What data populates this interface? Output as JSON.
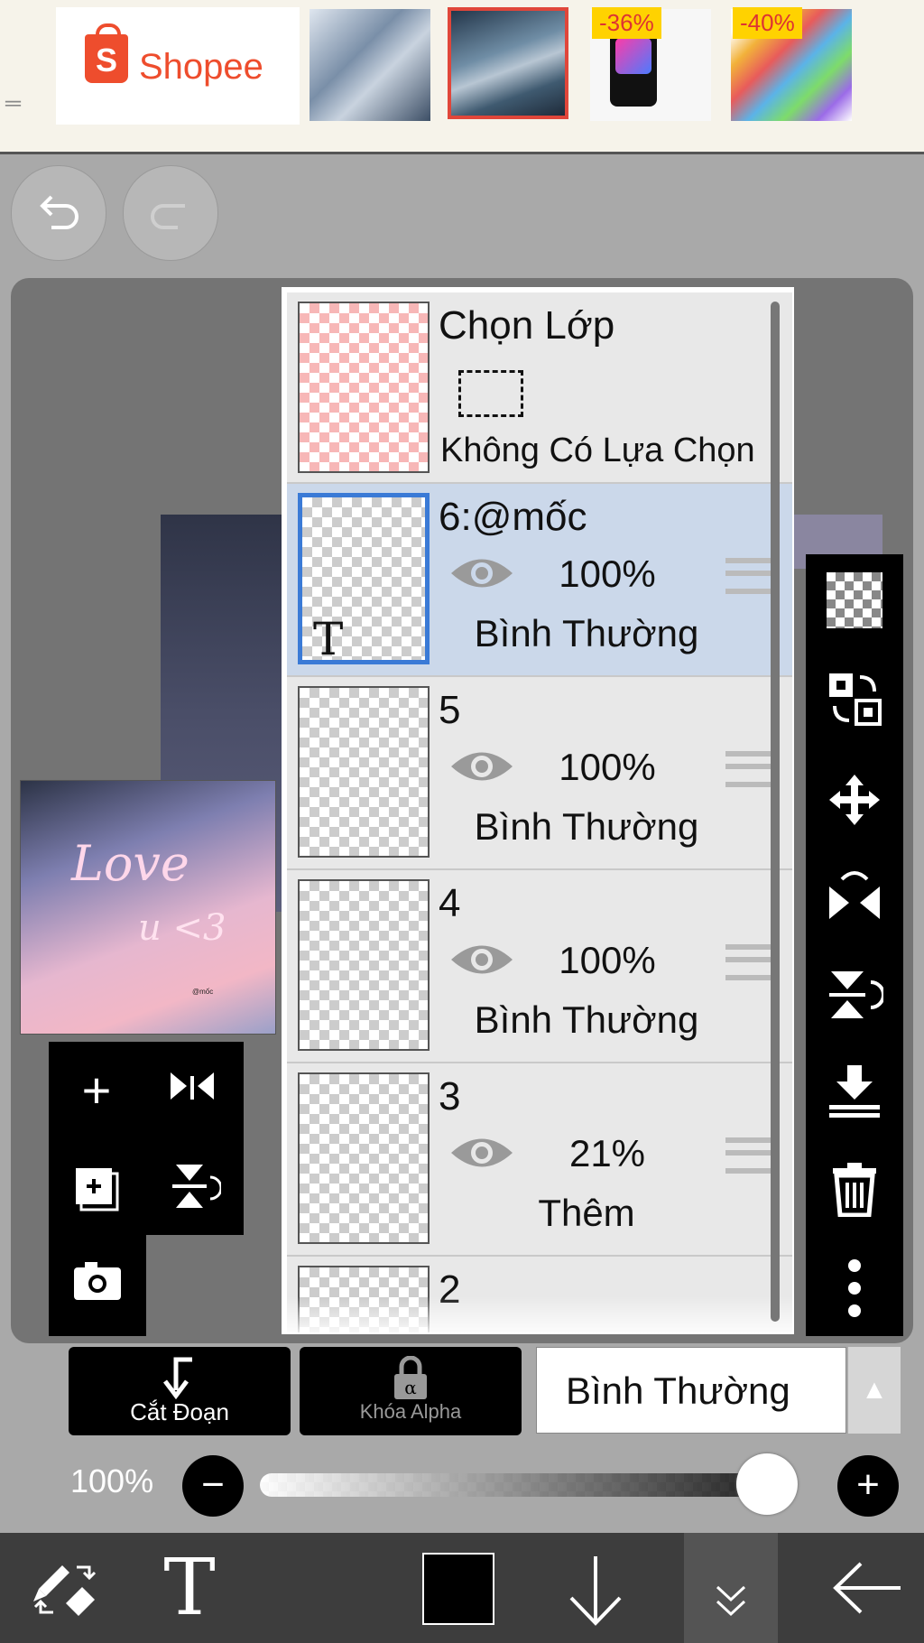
{
  "ad": {
    "brand": "Shopee",
    "discount_1": "-36%",
    "discount_2": "-40%"
  },
  "thumbnail": {
    "text_love": "Love",
    "text_u3": "u <3",
    "small_text": "@mốc"
  },
  "layers_panel": {
    "selection": {
      "title": "Chọn Lớp",
      "status": "Không Có Lựa Chọn"
    },
    "layers": [
      {
        "name": "6:@mốc",
        "opacity": "100%",
        "blend": "Bình Thường",
        "thumb_label": "T"
      },
      {
        "name": "5",
        "opacity": "100%",
        "blend": "Bình Thường"
      },
      {
        "name": "4",
        "opacity": "100%",
        "blend": "Bình Thường"
      },
      {
        "name": "3",
        "opacity": "21%",
        "blend": "Thêm"
      },
      {
        "name": "2"
      }
    ]
  },
  "bottom_controls": {
    "clip_label": "Cắt Đoạn",
    "alpha_lock_label": "Khóa Alpha",
    "blend_mode": "Bình Thường",
    "opacity_label": "100%",
    "opacity_value": 100
  },
  "toolbar": {
    "text_tool": "T"
  }
}
